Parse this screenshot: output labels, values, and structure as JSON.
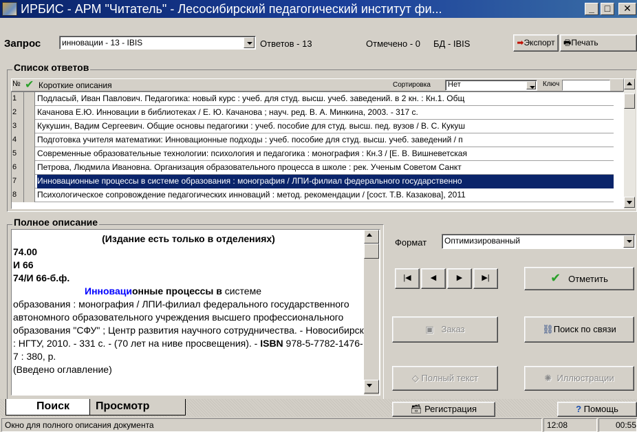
{
  "window": {
    "title": "ИРБИС - АРМ \"Читатель\" - Лесосибирский педагогический институт фи..."
  },
  "toolbar": {
    "query_label": "Запрос",
    "query_value": "инновации - 13 - IBIS",
    "answers": "Ответов - 13",
    "marked": "Отмечено - 0",
    "db": "БД - IBIS",
    "export_label": "Экспорт",
    "print_label": "Печать"
  },
  "results": {
    "group_label": "Список ответов",
    "col_num": "№",
    "col_desc": "Короткие описания",
    "sort_label": "Сортировка",
    "sort_value": "Нет",
    "key_label": "Ключ",
    "rows": [
      {
        "num": "1",
        "text": "Подласый, Иван Павлович. Педагогика: новый курс : учеб. для студ. высш. учеб. заведений. в 2 кн. : Кн.1. Общ"
      },
      {
        "num": "2",
        "text": "Качанова Е.Ю. Инновации в библиотеках / Е. Ю. Качанова ; науч. ред. В. А.  Минкина, 2003. - 317 с."
      },
      {
        "num": "3",
        "text": "Кукушин, Вадим Сергеевич. Общие основы педагогики : учеб. пособие для студ. высш. пед. вузов / В. С. Кукуш"
      },
      {
        "num": "4",
        "text": "Подготовка учителя математики: Инновационные подходы : учеб. пособие для студ. высш. учеб. заведений / п"
      },
      {
        "num": "5",
        "text": "Современные образовательные технологии: психология и педагогика : монография : Кн.3 / [Е. В. Вишневетская"
      },
      {
        "num": "6",
        "text": "Петрова, Людмила Ивановна. Организация образовательного процесса в школе : рек. Ученым Советом Санкт"
      },
      {
        "num": "7",
        "text": "Инновационные процессы в системе образования : монография / ЛПИ-филиал федерального государственно"
      },
      {
        "num": "8",
        "text": "Психологическое сопровождение педагогических инноваций : метод. рекомендации / [сост. Т.В. Казакова], 2011"
      }
    ],
    "selected_index": 6
  },
  "full": {
    "group_label": "Полное описание",
    "line1": "(Издание есть только в отделениях)",
    "line2": "74.00",
    "line3": "И 66",
    "line4": "74/И 66-б.ф.",
    "hl1": "Инноваци",
    "t1": "онные процессы в",
    "t2": " системе",
    "body": "образования : монография / ЛПИ-филиал федерального государственного автономного образовательного учреждения высшего профессионального образования \"СФУ\" ; Центр развития научного сотрудничества. - Новосибирск : НГТУ, 2010. - 331 с. - (70 лет на ниве просвещения). - ",
    "isbn_label": "ISBN",
    "isbn_value": " 978-5-7782-1476-7 : 380,  р.",
    "last": "(Введено оглавление)"
  },
  "right_panel": {
    "format_label": "Формат",
    "format_value": "Оптимизированный",
    "mark_label": "Отметить",
    "order_label": "Заказ",
    "link_search_label": "Поиск по связи",
    "full_text_label": "Полный текст",
    "illustrations_label": "Иллюстрации"
  },
  "tabs": {
    "search": "Поиск",
    "view": "Просмотр"
  },
  "bottom": {
    "registration_label": "Регистрация",
    "help_label": "Помощь"
  },
  "status": {
    "text": "Окно для полного описания документа",
    "time": "12:08",
    "timer": "00:55"
  },
  "colors": {
    "accent": "#0a246a",
    "highlight": "#0000ff",
    "check": "#2aa02a"
  }
}
